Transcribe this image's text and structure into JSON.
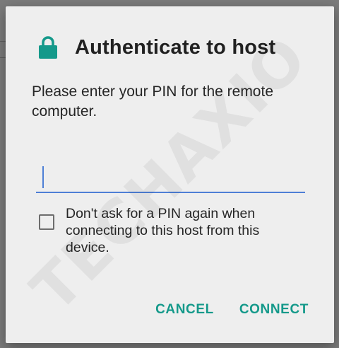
{
  "dialog": {
    "title": "Authenticate to host",
    "icon": "lock-icon",
    "message": "Please enter your PIN for the remote computer.",
    "pin_input": {
      "value": "",
      "placeholder": ""
    },
    "remember_checkbox": {
      "checked": false,
      "label": "Don't ask for a PIN again when connecting to this host from this device."
    },
    "buttons": {
      "cancel": "CANCEL",
      "connect": "CONNECT"
    }
  },
  "watermark": "TECHAXIO",
  "colors": {
    "accent": "#14998a",
    "input_underline": "#4e7fd6",
    "dialog_background": "#eeeeee",
    "text": "#212121"
  }
}
